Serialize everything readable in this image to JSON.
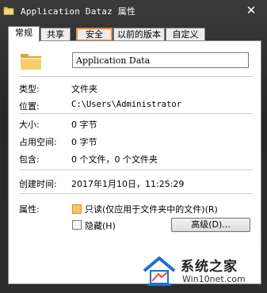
{
  "window": {
    "title": "Application Dataz 属性",
    "close_glyph": "✕"
  },
  "tabs": [
    {
      "label": "常规",
      "active": true
    },
    {
      "label": "共享",
      "active": false
    },
    {
      "label": "安全",
      "active": false,
      "highlighted": true
    },
    {
      "label": "以前的版本",
      "active": false
    },
    {
      "label": "自定义",
      "active": false
    }
  ],
  "general": {
    "name_value": "Application Data",
    "type": {
      "label": "类型:",
      "value": "文件夹"
    },
    "location": {
      "label": "位置:",
      "value": "C:\\Users\\Administrator"
    },
    "size": {
      "label": "大小:",
      "value": "0 字节"
    },
    "size_on_disk": {
      "label": "占用空间:",
      "value": "0 字节"
    },
    "contains": {
      "label": "包含:",
      "value": "0 个文件，0 个文件夹"
    },
    "created": {
      "label": "创建时间:",
      "value": "2017年1月10日，11:25:29"
    },
    "attributes": {
      "label": "属性:",
      "readonly_label": "只读(仅应用于文件夹中的文件)(R)",
      "readonly_state": "indeterminate",
      "hidden_label": "隐藏(H)",
      "hidden_checked": false,
      "advanced_button": "高级(D)..."
    }
  },
  "watermark": {
    "brand": "系统之家",
    "url": "Win10net.com"
  },
  "colors": {
    "highlight_outline": "#f0883c",
    "readonly_check": "#f4c46a",
    "logo_blue": "#1e6fd0"
  }
}
